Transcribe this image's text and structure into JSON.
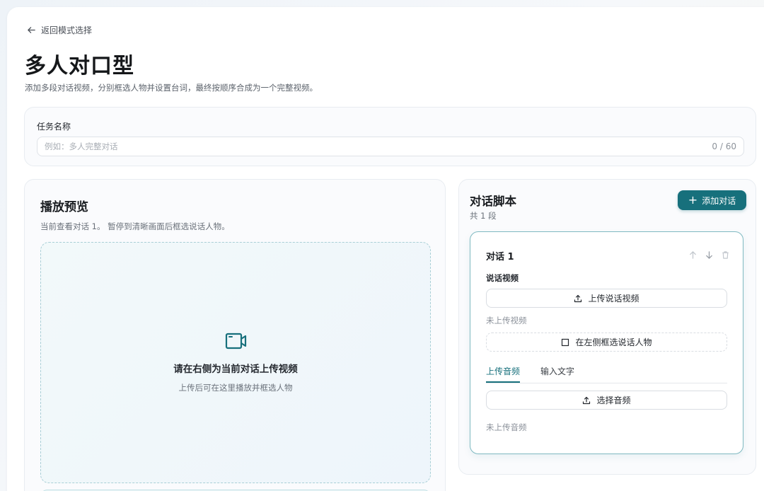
{
  "header": {
    "back_label": "返回模式选择",
    "title": "多人对口型",
    "subtitle": "添加多段对话视频，分别框选人物并设置台词，最终按顺序合成为一个完整视频。"
  },
  "task": {
    "label": "任务名称",
    "placeholder": "例如：多人完整对话",
    "value": "",
    "counter": "0 / 60"
  },
  "preview": {
    "title": "播放预览",
    "description": "当前查看对话 1。 暂停到清晰画面后框选说话人物。",
    "zone_title": "请在右侧为当前对话上传视频",
    "zone_hint": "上传后可在这里播放并框选人物"
  },
  "script": {
    "title": "对话脚本",
    "count": "共 1 段",
    "add_label": "添加对话",
    "dialogs": [
      {
        "title": "对话 1",
        "video_label": "说话视频",
        "upload_video_label": "上传说话视频",
        "video_status": "未上传视频",
        "select_person_label": "在左侧框选说话人物",
        "tabs": [
          "上传音频",
          "输入文字"
        ],
        "active_tab": 0,
        "select_audio_label": "选择音频",
        "audio_status": "未上传音频"
      }
    ]
  },
  "colors": {
    "accent": "#17707c",
    "accent_border": "#7fb9c1"
  },
  "icons": {
    "back": "arrow-left-icon",
    "camera": "video-camera-icon",
    "add": "plus-icon",
    "up": "arrow-up-icon",
    "down": "arrow-down-icon",
    "delete": "trash-icon",
    "upload": "upload-icon",
    "select": "square-icon"
  }
}
